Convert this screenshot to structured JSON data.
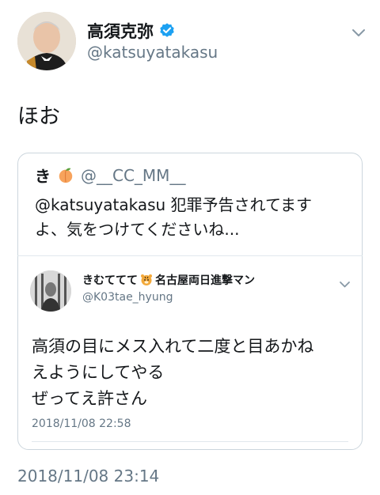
{
  "tweet": {
    "display_name": "高須克弥",
    "handle": "@katsuyatakasu",
    "text": "ほお",
    "timestamp": "2018/11/08 23:14"
  },
  "quoted_tweet": {
    "display_name": "き",
    "handle": "@__CC_MM__",
    "text_line1": "@katsuyatakasu 犯罪予告されてます",
    "text_line2": "よ、気をつけてくださいね..."
  },
  "embedded_tweet": {
    "display_name": "きむててて",
    "display_name_suffix": "名古屋両日進撃マン",
    "handle": "@K03tae_hyung",
    "text_line1": "高須の目にメス入れて二度と目あかね",
    "text_line2": "えようにしてやる",
    "text_line3": "ぜってえ許さん",
    "timestamp": "2018/11/08 22:58"
  },
  "icons": {
    "verified": "verified-badge-icon",
    "chevron": "chevron-down-icon",
    "peach": "peach-emoji-icon",
    "tiger": "tiger-emoji-icon"
  },
  "colors": {
    "verified_blue": "#1da1f2",
    "secondary_text": "#657786",
    "border": "#ccd6dd"
  }
}
